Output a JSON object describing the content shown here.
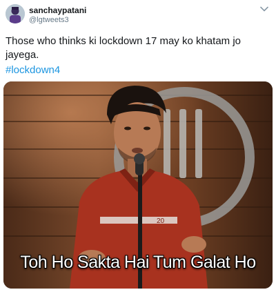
{
  "user": {
    "display_name": "sanchaypatani",
    "handle": "@lgtweets3",
    "avatar_icon": "avatar-icon"
  },
  "menu": {
    "icon": "chevron-down-icon"
  },
  "tweet": {
    "text": "Those who thinks ki lockdown 17 may ko khatam jo jayega.",
    "hashtag": "#lockdown4"
  },
  "media": {
    "subtitle": "Toh Ho Sakta Hai Tum Galat Ho",
    "shirt_text": "20"
  },
  "colors": {
    "text": "#14171a",
    "secondary": "#657786",
    "link": "#1b95e0"
  }
}
